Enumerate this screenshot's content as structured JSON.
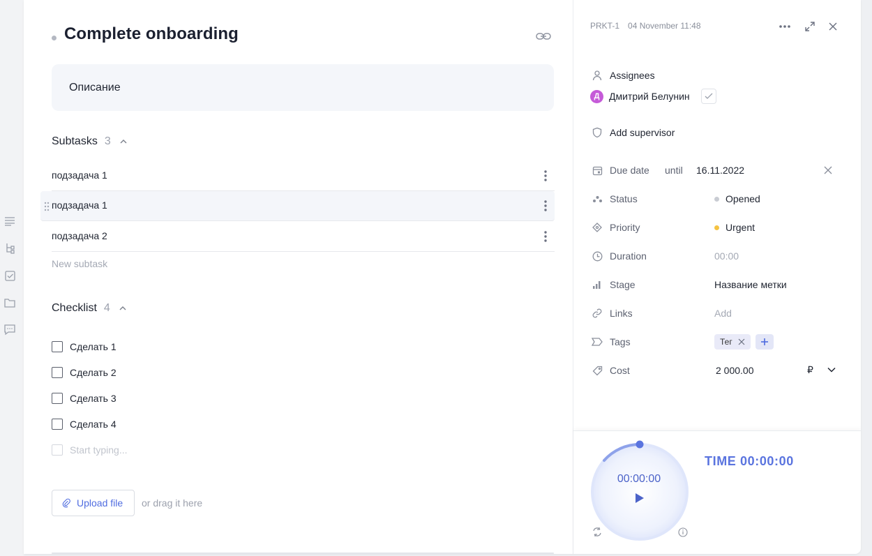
{
  "task": {
    "title": "Complete onboarding",
    "description": "Описание"
  },
  "subtasks": {
    "label": "Subtasks",
    "count": "3",
    "items": [
      {
        "label": "подзадача 1"
      },
      {
        "label": "подзадача 1"
      },
      {
        "label": "подзадача 2"
      }
    ],
    "new_placeholder": "New subtask"
  },
  "checklist": {
    "label": "Checklist",
    "count": "4",
    "items": [
      {
        "label": "Сделать 1",
        "checked": false
      },
      {
        "label": "Сделать 2",
        "checked": false
      },
      {
        "label": "Сделать 3",
        "checked": false
      },
      {
        "label": "Сделать 4",
        "checked": false
      }
    ],
    "new_placeholder": "Start typing..."
  },
  "upload": {
    "button": "Upload file",
    "hint": "or drag it here"
  },
  "side": {
    "task_id": "PRKT-1",
    "created": "04 November 11:48",
    "assignees_label": "Assignees",
    "assignee": {
      "initial": "Д",
      "name": "Дмитрий Белунин"
    },
    "supervisor_label": "Add supervisor",
    "due": {
      "label": "Due date",
      "prefix": "until",
      "value": "16.11.2022"
    },
    "status": {
      "label": "Status",
      "value": "Opened",
      "color": "#c9ccd3"
    },
    "priority": {
      "label": "Priority",
      "value": "Urgent",
      "color": "#f5c342"
    },
    "duration": {
      "label": "Duration",
      "value": "00:00"
    },
    "stage": {
      "label": "Stage",
      "value": "Название метки"
    },
    "links": {
      "label": "Links",
      "value": "Add"
    },
    "tags": {
      "label": "Tags",
      "items": [
        "Тег"
      ]
    },
    "cost": {
      "label": "Cost",
      "value": "2 000.00",
      "currency": "₽"
    }
  },
  "timer": {
    "display": "00:00:00",
    "total": "TIME 00:00:00",
    "accent": "#5a74df"
  },
  "icons": {
    "rail": [
      "list-icon",
      "hierarchy-icon",
      "checkbox-icon",
      "folder-icon",
      "chat-icon"
    ]
  }
}
